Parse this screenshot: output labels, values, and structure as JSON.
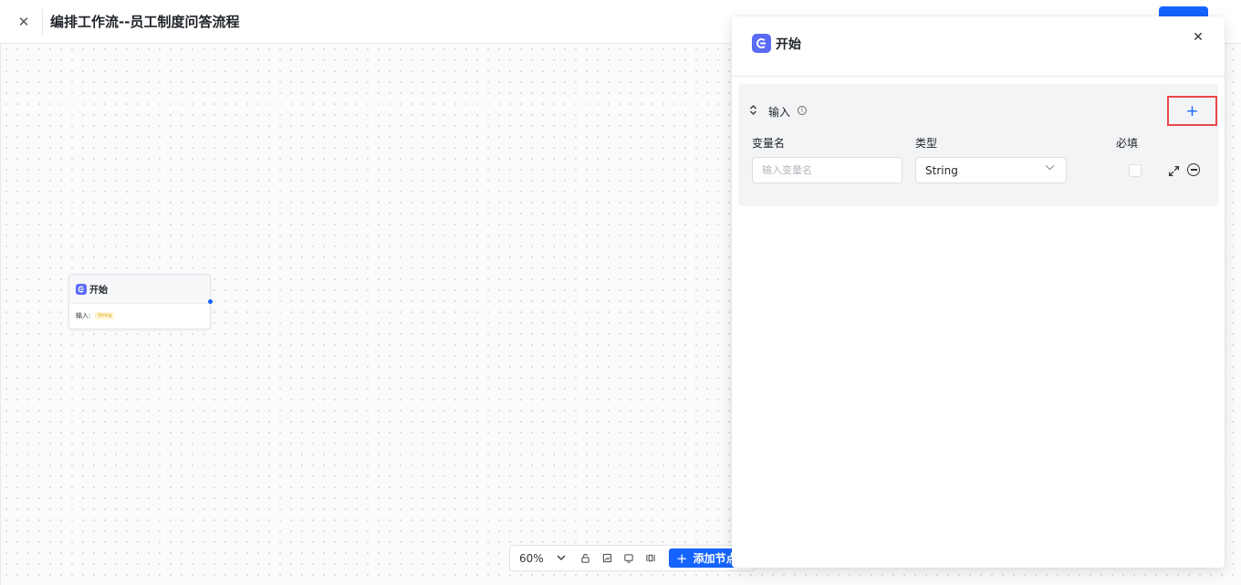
{
  "header": {
    "title": "编排工作流--员工制度问答流程",
    "close_glyph": "✕",
    "publish_label": ""
  },
  "canvas": {
    "node": {
      "title": "开始",
      "input_label": "输入:",
      "input_type_tag": "String"
    }
  },
  "toolbar": {
    "zoom_level": "60%",
    "add_node_label": "添加节点",
    "icons": [
      "lock-icon",
      "minimap-icon",
      "fit-view-icon",
      "layout-icon"
    ]
  },
  "panel": {
    "title": "开始",
    "close_glyph": "✕",
    "section": {
      "label": "输入",
      "add_glyph": "+",
      "columns": {
        "name": "变量名",
        "type": "类型",
        "required": "必填"
      },
      "row": {
        "name_value": "",
        "name_placeholder": "输入变量名",
        "type_value": "String",
        "required": false
      }
    }
  },
  "colors": {
    "accent": "#1664ff",
    "node_icon": "#5a6cf5",
    "highlight": "#e8474c"
  }
}
